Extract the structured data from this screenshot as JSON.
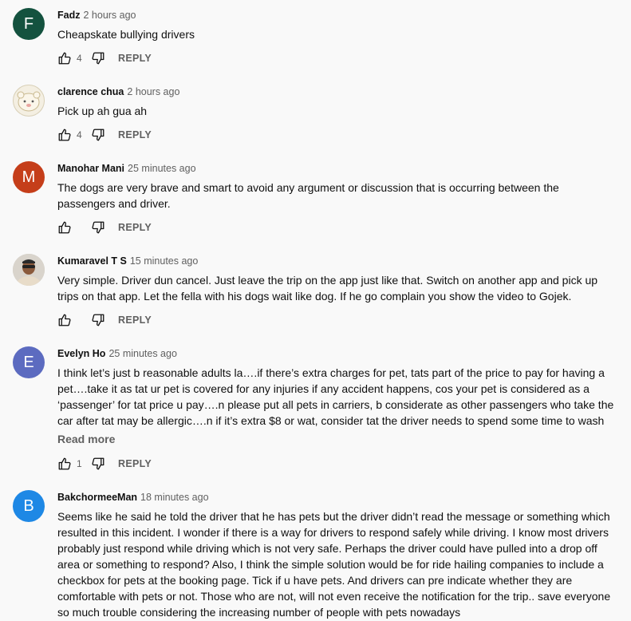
{
  "comments": [
    {
      "initial": "F",
      "avatar_color": "#14523f",
      "author": "Fadz",
      "time": "2 hours ago",
      "text": "Cheapskate bullying drivers",
      "likes": "4",
      "reply": "REPLY"
    },
    {
      "author": "clarence chua",
      "time": "2 hours ago",
      "text": "Pick up ah gua ah",
      "likes": "4",
      "reply": "REPLY"
    },
    {
      "initial": "M",
      "avatar_color": "#c53e1a",
      "author": "Manohar Mani",
      "time": "25 minutes ago",
      "text": "The dogs are very brave and smart to avoid any argument or discussion that is occurring between the passengers and driver.",
      "likes": "",
      "reply": "REPLY"
    },
    {
      "author": "Kumaravel T S",
      "time": "15 minutes ago",
      "text": "Very simple. Driver dun cancel. Just leave the trip on the app just like that. Switch on another app and pick up trips on that app. Let the fella with his dogs wait like dog. If he go complain you show the video to Gojek.",
      "likes": "",
      "reply": "REPLY"
    },
    {
      "initial": "E",
      "avatar_color": "#5c6bc0",
      "author": "Evelyn Ho",
      "time": "25 minutes ago",
      "text": "I think let’s just b reasonable adults la….if there’s extra charges for pet, tats part of the price to pay for having a pet….take it as tat ur pet is covered for any injuries if any accident happens, cos your pet is considered as a ‘passenger’ for tat price u pay….n please put all pets in carriers, b considerate as other passengers who take the car after tat may be allergic….n if it’s extra $8 or wat, consider tat the driver needs to spend some time to wash …",
      "read_more": "Read more",
      "likes": "1",
      "reply": "REPLY"
    },
    {
      "initial": "B",
      "avatar_color": "#1e88e5",
      "author": "BakchormeeMan",
      "time": "18 minutes ago",
      "text": "Seems like he said he told the driver that he has pets but the driver didn’t read the message or something which resulted in this incident. I wonder if there is a way for drivers to respond safely while driving. I know most drivers probably just respond while driving which is not very safe. Perhaps the driver could have pulled into a drop off area or something to respond? Also, I think the simple solution would be for ride hailing companies to include a checkbox for pets at the booking page. Tick if u have pets. And drivers can pre indicate whether they are comfortable with pets or not. Those who are not, will not even receive the notification for the trip.. save everyone so much trouble considering the increasing number of people with pets nowadays"
    }
  ]
}
